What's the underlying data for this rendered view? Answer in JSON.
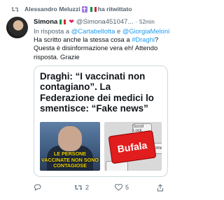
{
  "retweet": {
    "user": "Alessandro Meluzzi",
    "suffix": "ha ritwittato"
  },
  "tweet": {
    "author_name": "Simona",
    "author_handle": "@Simona451047...",
    "time": "52min",
    "reply_prefix": "In risposta a",
    "reply_user1": "@Cartabellotta",
    "reply_and": "e",
    "reply_user2": "@GiorgiaMeloni",
    "text_part1": "Ha scritto anche la stessa cosa a",
    "hashtag": "#Draghi",
    "text_part2": "? Questa è disinformazione vera eh! Attendo risposta. Grazie"
  },
  "card": {
    "title": "Draghi: “I vaccinati non contagiano”. La Federazione dei medici lo smentisce: “Fake news”",
    "left_caption": "LE PERSONE VACCINATE NON SONO CONTAGIOSE",
    "key_big": "Bufala",
    "key_scroll": "Scroll Lock",
    "key_home": "Home"
  },
  "actions": {
    "retweet_count": "2",
    "like_count": "5"
  }
}
